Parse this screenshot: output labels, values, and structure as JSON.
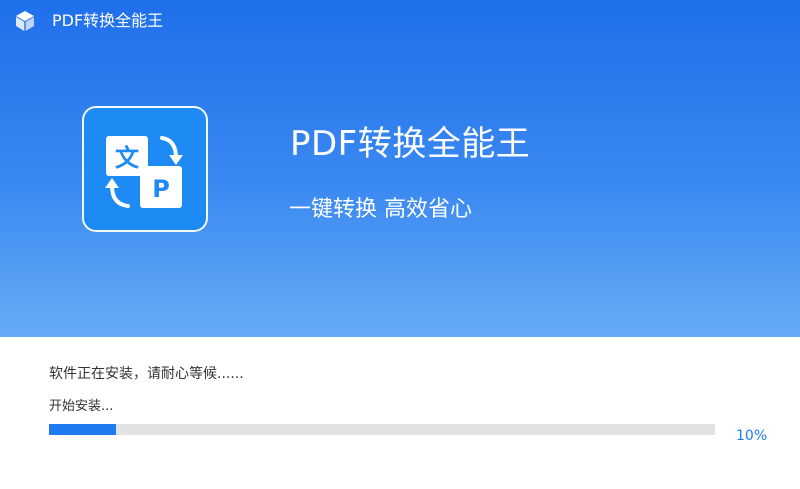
{
  "window": {
    "title": "PDF转换全能王",
    "icon": "cube-icon"
  },
  "hero": {
    "title": "PDF转换全能王",
    "subtitle": "一键转换 高效省心",
    "logo": {
      "icon": "document-convert-icon",
      "text_glyph": "文",
      "pdf_glyph": "P"
    }
  },
  "install": {
    "status": "软件正在安装，请耐心等候......",
    "step": "开始安装...",
    "progress_fraction": 0.1,
    "progress_label": "10%"
  },
  "colors": {
    "banner_top": "#1F6FEB",
    "banner_bottom": "#66ACF6",
    "accent": "#1E7BF2",
    "track": "#E2E2E2"
  }
}
